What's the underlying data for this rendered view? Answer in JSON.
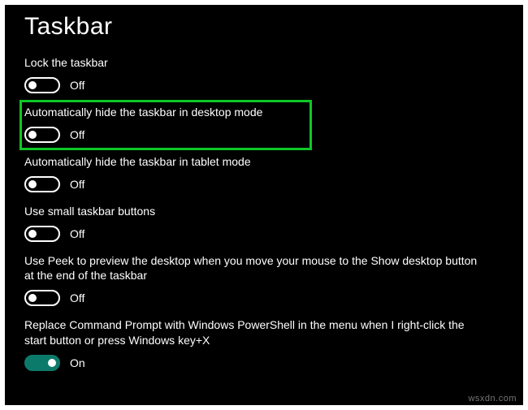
{
  "title": "Taskbar",
  "settings": [
    {
      "label": "Lock the taskbar",
      "state": "Off",
      "on": false
    },
    {
      "label": "Automatically hide the taskbar in desktop mode",
      "state": "Off",
      "on": false,
      "highlight": true
    },
    {
      "label": "Automatically hide the taskbar in tablet mode",
      "state": "Off",
      "on": false
    },
    {
      "label": "Use small taskbar buttons",
      "state": "Off",
      "on": false
    },
    {
      "label": "Use Peek to preview the desktop when you move your mouse to the Show desktop button at the end of the taskbar",
      "state": "Off",
      "on": false
    },
    {
      "label": "Replace Command Prompt with Windows PowerShell in the menu when I right-click the start button or press Windows key+X",
      "state": "On",
      "on": true
    }
  ],
  "watermark": "wsxdn.com"
}
